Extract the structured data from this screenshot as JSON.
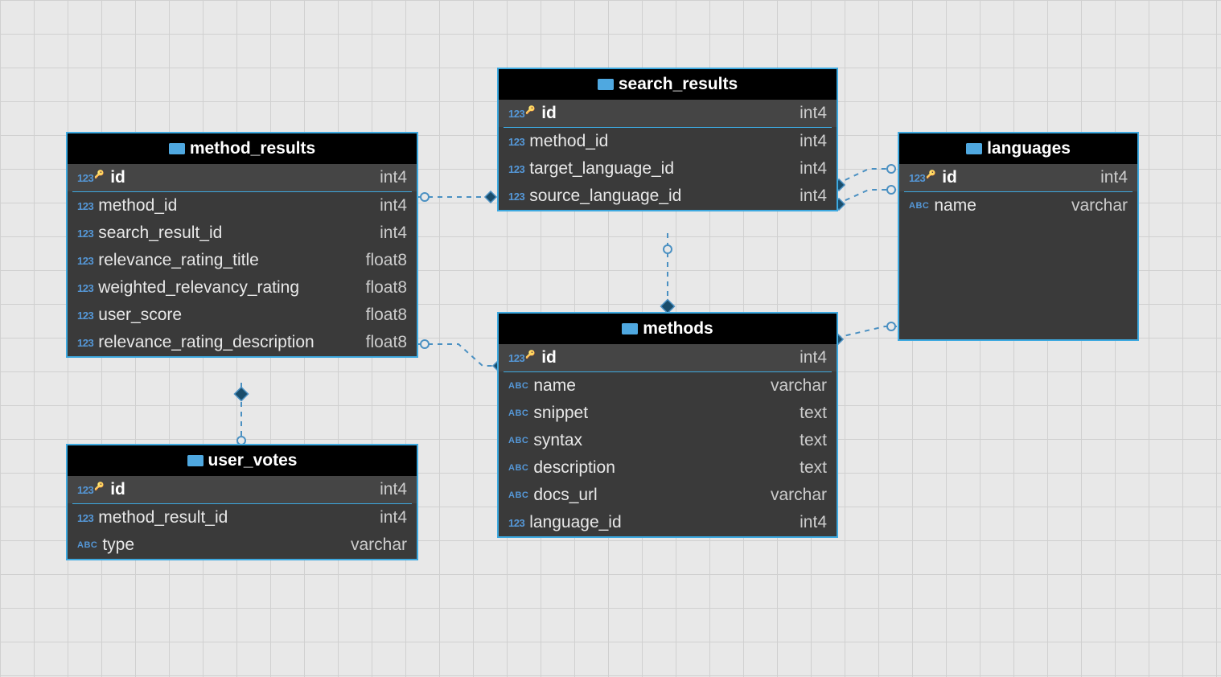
{
  "tables": {
    "method_results": {
      "title": "method_results",
      "pk": {
        "name": "id",
        "type": "int4",
        "prefix": "123"
      },
      "cols": [
        {
          "name": "method_id",
          "type": "int4",
          "prefix": "123"
        },
        {
          "name": "search_result_id",
          "type": "int4",
          "prefix": "123"
        },
        {
          "name": "relevance_rating_title",
          "type": "float8",
          "prefix": "123"
        },
        {
          "name": "weighted_relevancy_rating",
          "type": "float8",
          "prefix": "123"
        },
        {
          "name": "user_score",
          "type": "float8",
          "prefix": "123"
        },
        {
          "name": "relevance_rating_description",
          "type": "float8",
          "prefix": "123"
        }
      ]
    },
    "search_results": {
      "title": "search_results",
      "pk": {
        "name": "id",
        "type": "int4",
        "prefix": "123"
      },
      "cols": [
        {
          "name": "method_id",
          "type": "int4",
          "prefix": "123"
        },
        {
          "name": "target_language_id",
          "type": "int4",
          "prefix": "123"
        },
        {
          "name": "source_language_id",
          "type": "int4",
          "prefix": "123"
        }
      ]
    },
    "languages": {
      "title": "languages",
      "pk": {
        "name": "id",
        "type": "int4",
        "prefix": "123"
      },
      "cols": [
        {
          "name": "name",
          "type": "varchar",
          "prefix": "ABC"
        }
      ]
    },
    "methods": {
      "title": "methods",
      "pk": {
        "name": "id",
        "type": "int4",
        "prefix": "123"
      },
      "cols": [
        {
          "name": "name",
          "type": "varchar",
          "prefix": "ABC"
        },
        {
          "name": "snippet",
          "type": "text",
          "prefix": "ABC"
        },
        {
          "name": "syntax",
          "type": "text",
          "prefix": "ABC"
        },
        {
          "name": "description",
          "type": "text",
          "prefix": "ABC"
        },
        {
          "name": "docs_url",
          "type": "varchar",
          "prefix": "ABC"
        },
        {
          "name": "language_id",
          "type": "int4",
          "prefix": "123"
        }
      ]
    },
    "user_votes": {
      "title": "user_votes",
      "pk": {
        "name": "id",
        "type": "int4",
        "prefix": "123"
      },
      "cols": [
        {
          "name": "method_result_id",
          "type": "int4",
          "prefix": "123"
        },
        {
          "name": "type",
          "type": "varchar",
          "prefix": "ABC"
        }
      ]
    }
  }
}
